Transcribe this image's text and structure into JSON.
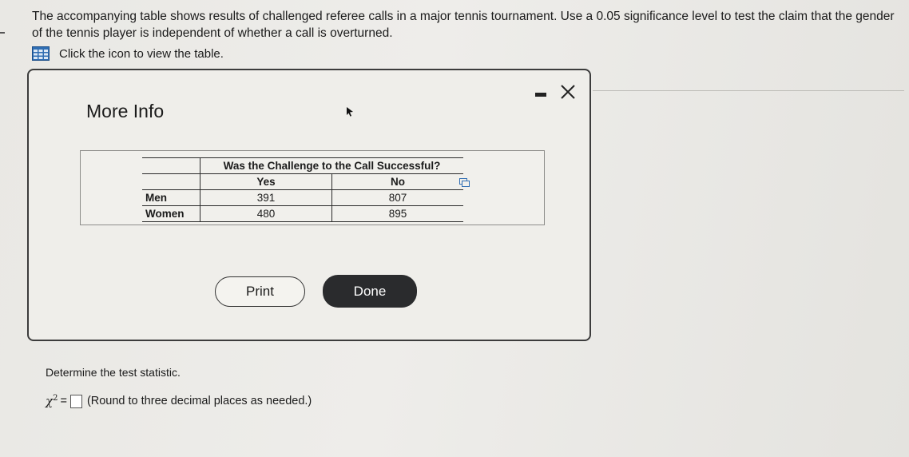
{
  "question": {
    "text": "The accompanying table shows results of challenged referee calls in a major tennis tournament. Use a 0.05 significance level to test the claim that the gender of the tennis player is independent of whether a call is overturned.",
    "view_table_link": "Click the icon to view the table."
  },
  "dialog": {
    "title": "More Info",
    "table": {
      "span_header": "Was the Challenge to the Call Successful?",
      "columns": [
        "Yes",
        "No"
      ],
      "rows": [
        {
          "label": "Men",
          "values": [
            "391",
            "807"
          ]
        },
        {
          "label": "Women",
          "values": [
            "480",
            "895"
          ]
        }
      ]
    },
    "print_label": "Print",
    "done_label": "Done"
  },
  "answer": {
    "prompt": "Determine the test statistic.",
    "chi_label": "χ",
    "chi_exp": "2",
    "equals": "=",
    "hint": "(Round to three decimal places as needed.)"
  },
  "icons": [
    "table-icon",
    "minimize-icon",
    "close-icon",
    "copy-icon",
    "cursor-icon"
  ]
}
